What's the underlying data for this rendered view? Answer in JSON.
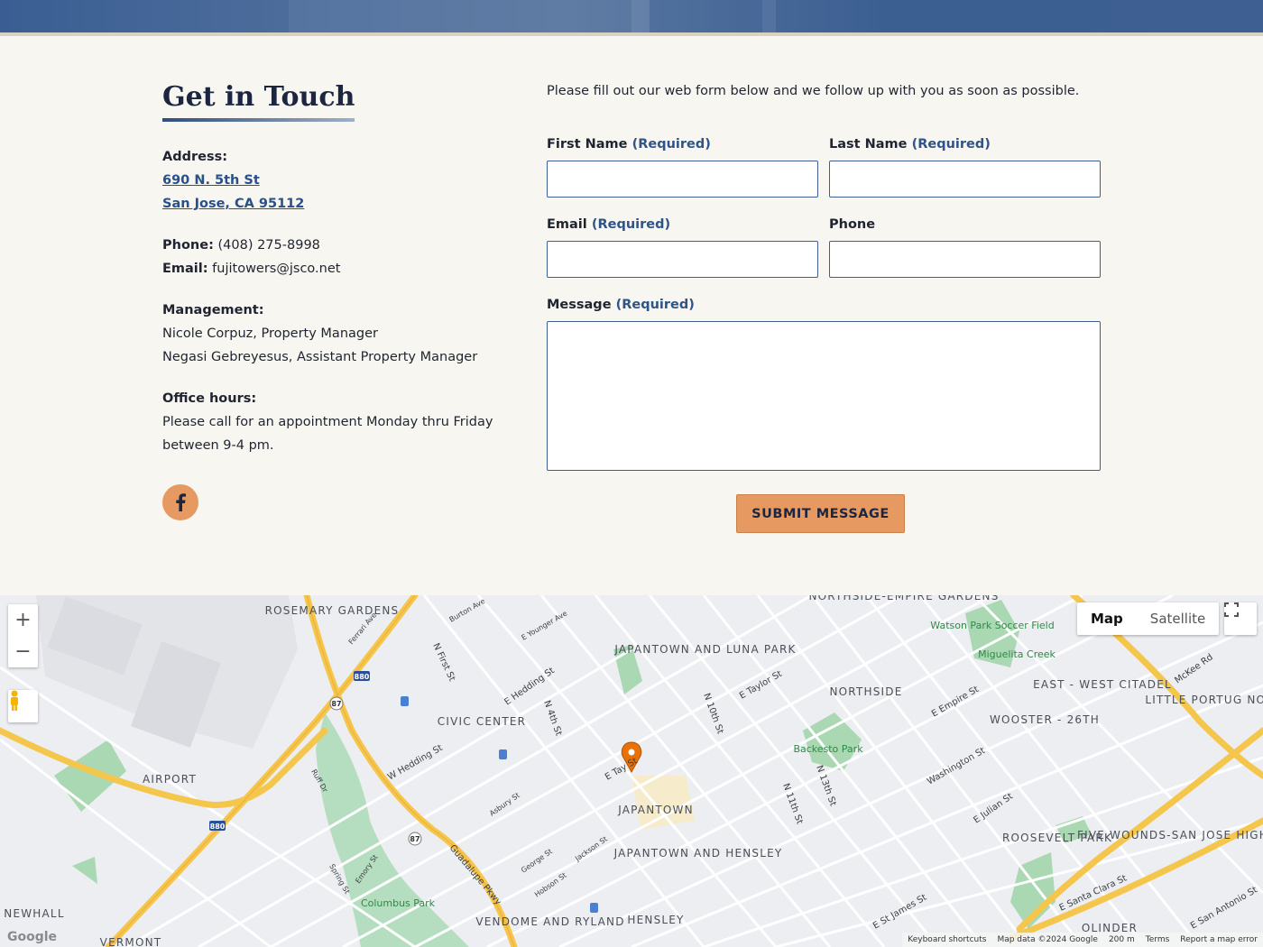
{
  "contact": {
    "heading": "Get in Touch",
    "address_label": "Address:",
    "address_line1": "690 N. 5th St",
    "address_line2": "San Jose, CA 95112",
    "phone_label": "Phone:",
    "phone_value": "(408) 275-8998",
    "email_label": "Email:",
    "email_value": "fujitowers@jsco.net",
    "management_label": "Management:",
    "managers": [
      "Nicole Corpuz, Property Manager",
      "Negasi Gebreyesus, Assistant Property Manager"
    ],
    "hours_label": "Office hours:",
    "hours_line1": "Please call for an appointment Monday thru Friday",
    "hours_line2": "between 9-4 pm.",
    "social_icon": "facebook-icon"
  },
  "form": {
    "intro": "Please fill out our web form below and we follow up with you as soon as possible.",
    "first_name": "First Name",
    "last_name": "Last Name",
    "email": "Email",
    "phone": "Phone",
    "message": "Message",
    "required": "(Required)",
    "submit": "SUBMIT MESSAGE",
    "first_name_value": "",
    "last_name_value": "",
    "email_value": "",
    "phone_value": "",
    "message_value": ""
  },
  "map": {
    "zoom_in": "+",
    "zoom_out": "−",
    "type_map": "Map",
    "type_satellite": "Satellite",
    "logo": "Google",
    "footer": [
      "Keyboard shortcuts",
      "Map data ©2024 Google",
      "200 m",
      "Terms",
      "Report a map error"
    ],
    "areas": [
      "ROSEMARY GARDENS",
      "CIVIC CENTER",
      "JAPANTOWN AND LUNA PARK",
      "NORTHSIDE",
      "NORTHSIDE-EMPIRE GARDENS",
      "EAST - WEST CITADEL",
      "WOOSTER - 26TH",
      "LITTLE PORTUG NORTH",
      "AIRPORT",
      "JAPANTOWN",
      "JAPANTOWN AND HENSLEY",
      "ROOSEVELT PARK",
      "FIVE WOUNDS-SAN JOSE HIGH",
      "VENDOME AND RYLAND",
      "HENSLEY",
      "OLINDER",
      "NEWHALL",
      "VERMONT"
    ],
    "parks": [
      "Watson Park Soccer Field",
      "Miguelita Creek",
      "Backesto Park",
      "Columbus Park"
    ],
    "streets": [
      "N First St",
      "N 4th St",
      "E Hedding St",
      "W Hedding St",
      "E Taylor St",
      "N 10th St",
      "N 11th St",
      "N 13th St",
      "E Julian St",
      "E Santa Clara St",
      "Guadalupe Pkwy",
      "E St James St",
      "E Empire St",
      "Washington St",
      "McKee Rd",
      "E San Antonio St",
      "E Tay  St",
      "Burton Ave",
      "Ferrari Ave",
      "E Younger Ave",
      "Ruff Dr",
      "Emory St",
      "Spring St",
      "Asbury St",
      "George St",
      "Hobson St",
      "Jackson St"
    ],
    "highways": [
      "880",
      "87"
    ]
  }
}
